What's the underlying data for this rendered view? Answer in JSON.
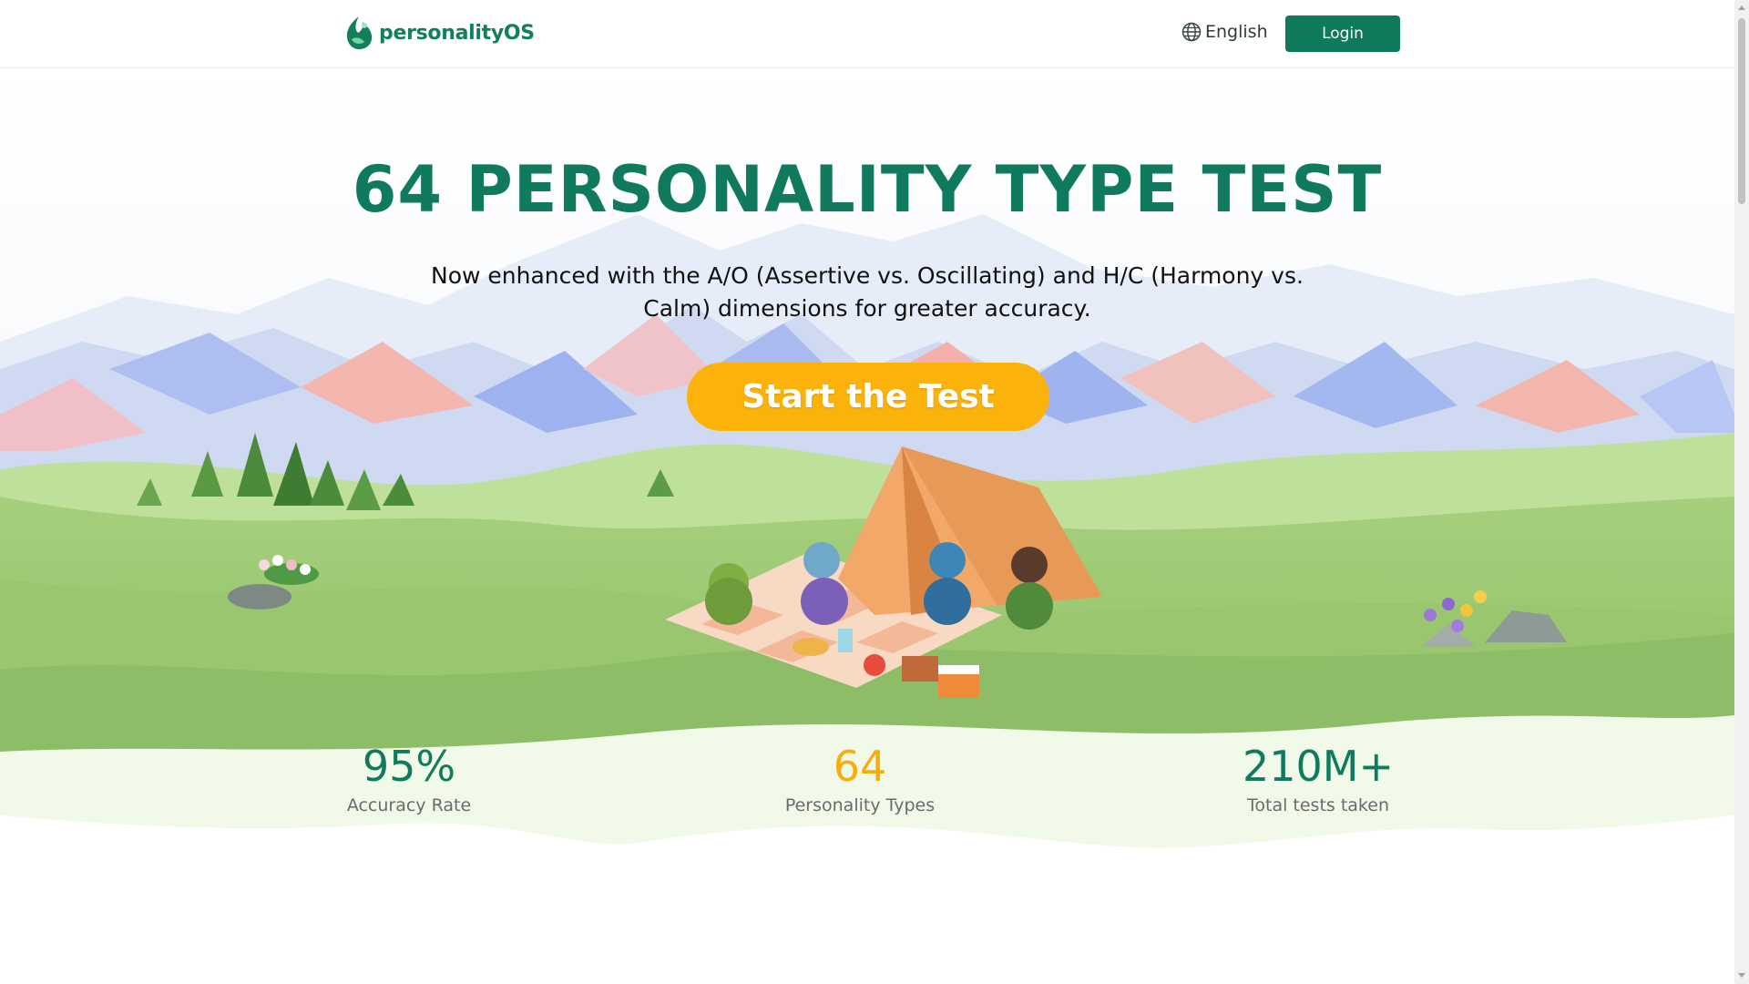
{
  "header": {
    "logo_text": "personalityOS",
    "language_label": "English",
    "login_label": "Login"
  },
  "hero": {
    "title": "64 PERSONALITY TYPE TEST",
    "subtitle": "Now enhanced with the A/O (Assertive vs. Oscillating) and H/C (Harmony vs. Calm) dimensions for greater accuracy.",
    "cta_label": "Start the Test"
  },
  "stats": [
    {
      "value": "95%",
      "label": "Accuracy Rate",
      "color": "#0f7a5d"
    },
    {
      "value": "64",
      "label": "Personality Types",
      "color": "#f6ad0d"
    },
    {
      "value": "210M+",
      "label": "Total tests taken",
      "color": "#0f7a5d"
    }
  ],
  "colors": {
    "brand_green": "#0e7a5b",
    "cta_yellow": "#fbb30c"
  },
  "icons": {
    "logo": "leaf-flame-logo-icon",
    "language": "globe-icon"
  }
}
